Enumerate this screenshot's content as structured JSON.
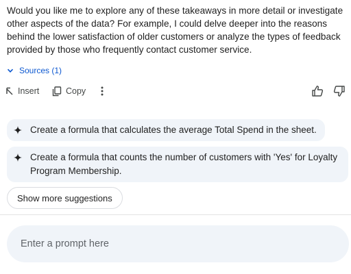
{
  "response": {
    "text": "Would you like me to explore any of these takeaways in more detail or investigate other aspects of the data? For example, I could delve deeper into the reasons behind the lower satisfaction of older customers or analyze the types of feedback provided by those who frequently contact customer service."
  },
  "sources": {
    "label": "Sources (1)",
    "icon": "chevron-down-icon"
  },
  "actions": {
    "insert_label": "Insert",
    "copy_label": "Copy",
    "icons": [
      "insert-icon",
      "copy-icon",
      "more-vert-icon",
      "thumbs-up-icon",
      "thumbs-down-icon"
    ]
  },
  "suggestions": [
    {
      "text": "Create a formula that calculates the average Total Spend in the sheet.",
      "icon": "sparkle-icon"
    },
    {
      "text": "Create a formula that counts the number of customers with 'Yes' for Loyalty Program Membership.",
      "icon": "sparkle-icon"
    }
  ],
  "show_more_label": "Show more suggestions",
  "prompt": {
    "placeholder": "Enter a prompt here",
    "value": ""
  },
  "colors": {
    "accent": "#0b57d0",
    "chip_bg": "#f0f4f9",
    "text": "#1f1f1f",
    "muted": "#444746"
  }
}
